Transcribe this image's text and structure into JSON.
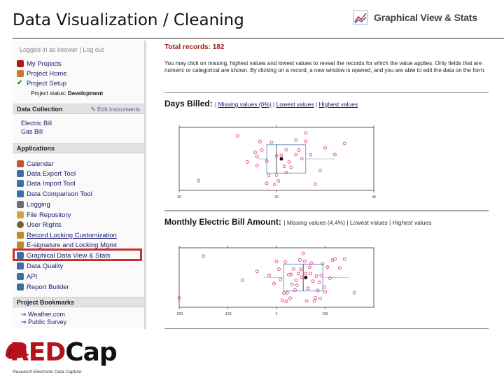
{
  "slide": {
    "title": "Data Visualization / Cleaning"
  },
  "header": {
    "icon": "chart-icon",
    "title": "Graphical View & Stats"
  },
  "sidebar": {
    "logged_in": "Logged in as keewer | Log out",
    "items_top": [
      {
        "label": "My Projects",
        "icon": "home-icon",
        "color": "#b5121b"
      },
      {
        "label": "Project Home",
        "icon": "home-icon",
        "color": "#c67a2c"
      },
      {
        "label": "Project Setup",
        "icon": "checkmark-icon",
        "color": "#2f8f2f"
      }
    ],
    "project_status_label": "Project status:",
    "project_status_value": "Development",
    "data_collection": {
      "title": "Data Collection",
      "edit_label": "Edit instruments",
      "links": [
        "Electric Bill",
        "Gas Bill"
      ]
    },
    "applications": {
      "title": "Applications",
      "items": [
        {
          "label": "Calendar",
          "icon": "calendar-icon",
          "color": "#c0562b"
        },
        {
          "label": "Data Export Tool",
          "icon": "export-icon",
          "color": "#3d6ea8"
        },
        {
          "label": "Data Import Tool",
          "icon": "import-icon",
          "color": "#3d6ea8"
        },
        {
          "label": "Data Comparison Tool",
          "icon": "compare-icon",
          "color": "#3d6ea8"
        },
        {
          "label": "Logging",
          "icon": "logging-icon",
          "color": "#6e6e6e"
        },
        {
          "label": "File Repository",
          "icon": "file-icon",
          "color": "#cfa43b"
        },
        {
          "label": "User Rights",
          "icon": "user-icon",
          "color": "#7a5c2e"
        },
        {
          "label": "Record Locking Customization",
          "icon": "lock-icon",
          "color": "#c08a2a"
        },
        {
          "label": "E-signature and Locking Mgmt",
          "icon": "signature-icon",
          "color": "#c08a2a"
        },
        {
          "label": "Graphical Data View & Stats",
          "icon": "chart-icon",
          "color": "#3d6ea8"
        },
        {
          "label": "Data Quality",
          "icon": "quality-icon",
          "color": "#3d6ea8"
        },
        {
          "label": "API",
          "icon": "api-icon",
          "color": "#3d6ea8"
        },
        {
          "label": "Report Builder",
          "icon": "report-icon",
          "color": "#3d6ea8"
        }
      ]
    },
    "bookmarks": {
      "title": "Project Bookmarks",
      "links": [
        "Weather.com",
        "Public Survey"
      ]
    }
  },
  "main": {
    "total_records": "Total records: 182",
    "description": "You may click on missing, highest values and lowest values to reveal the records for which the value applies. Only fields that are numeric or categorical are shown. By clicking on a record, a new window is opened, and you are able to edit the data on the form.",
    "section1": {
      "title": "Days Billed:",
      "missing": "Missing values (0%)",
      "lowest": "Lowest values",
      "highest": "Highest values"
    },
    "section2": {
      "title": "Monthly Electric Bill Amount:",
      "missing": "Missing values (4.4%)",
      "lowest": "Lowest values",
      "highest": "Highest values"
    }
  },
  "chart_data": [
    {
      "type": "scatter",
      "title": "Days Billed",
      "xlim": [
        20,
        40
      ],
      "x_ticks": [
        "20",
        "30",
        "40"
      ],
      "box": {
        "q1": 29,
        "median": 30,
        "q3": 33,
        "whisker_low": 28,
        "whisker_high": 36,
        "mean": 30.5
      },
      "points": [
        22,
        26,
        27,
        27.8,
        28,
        28,
        28.3,
        28.5,
        29,
        29,
        29.2,
        29.5,
        29.8,
        30,
        30,
        30.2,
        30.5,
        30.8,
        31,
        31,
        31.3,
        31.5,
        32,
        32,
        32.3,
        32.6,
        33,
        33,
        33.5,
        34,
        34.5,
        35,
        36,
        37
      ],
      "grid": false
    },
    {
      "type": "scatter",
      "title": "Monthly Electric Bill Amount",
      "xlim": [
        -200,
        200
      ],
      "x_ticks": [
        "-200",
        "-100",
        "0",
        "100"
      ],
      "box": {
        "q1": 15,
        "median": 55,
        "q3": 95,
        "whisker_low": -25,
        "whisker_high": 150,
        "mean": 60
      },
      "points": [
        -200,
        -150,
        -70,
        -40,
        -15,
        -5,
        0,
        5,
        8,
        12,
        15,
        18,
        20,
        22,
        25,
        28,
        30,
        32,
        35,
        38,
        40,
        42,
        45,
        48,
        50,
        52,
        55,
        58,
        60,
        62,
        65,
        68,
        70,
        72,
        75,
        78,
        80,
        82,
        85,
        88,
        90,
        92,
        95,
        98,
        100,
        105,
        110,
        115,
        120,
        130,
        140,
        160
      ],
      "grid": false
    }
  ],
  "logo": {
    "word_red": "RED",
    "word_black": "Cap",
    "subtitle": "Research Electronic Data Capture"
  },
  "colors": {
    "accent": "#b5121b",
    "point": "#d6336c",
    "link": "#1a1a6e"
  }
}
